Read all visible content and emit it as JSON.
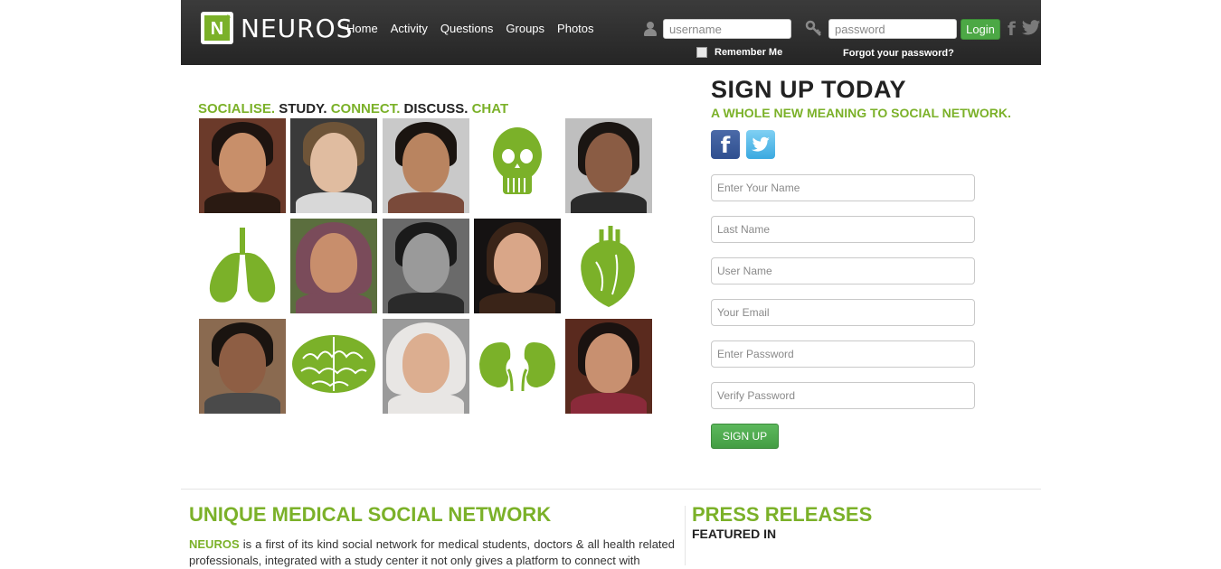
{
  "header": {
    "logo_letter": "N",
    "logo_text": "NEUROS",
    "nav": [
      "Home",
      "Activity",
      "Questions",
      "Groups",
      "Photos"
    ],
    "username_placeholder": "username",
    "password_placeholder": "password",
    "login_label": "Login",
    "remember_label": "Remember Me",
    "forgot_label": "Forgot your password?",
    "facebook_glyph": "f"
  },
  "hero": {
    "tagline": [
      {
        "text": "SOCIALISE.",
        "color": "green"
      },
      {
        "text": "STUDY.",
        "color": "dark"
      },
      {
        "text": "CONNECT.",
        "color": "green"
      },
      {
        "text": "DISCUSS.",
        "color": "dark"
      },
      {
        "text": "CHAT",
        "color": "green"
      }
    ],
    "tiles": [
      "photo",
      "photo",
      "photo",
      "skull-icon",
      "photo",
      "lungs-icon",
      "photo",
      "photo",
      "photo",
      "heart-icon",
      "photo",
      "brain-icon",
      "photo",
      "kidneys-icon",
      "photo"
    ]
  },
  "signup": {
    "title": "SIGN UP TODAY",
    "subtitle": "A WHOLE NEW MEANING TO SOCIAL NETWORK.",
    "facebook_glyph": "f",
    "fields": [
      "Enter Your Name",
      "Last Name",
      "User Name",
      "Your Email",
      "Enter Password",
      "Verify Password"
    ],
    "button": "SIGN UP"
  },
  "unique": {
    "heading": "UNIQUE MEDICAL SOCIAL NETWORK",
    "brand": "NEUROS",
    "text": " is a first of its kind social network for medical students, doctors & all health related professionals, integrated with a study center it not only gives a platform to connect with"
  },
  "press": {
    "heading": "PRESS RELEASES",
    "subheading": "FEATURED IN"
  },
  "colors": {
    "accent": "#7bb129",
    "dark": "#222222",
    "header_bg": "#2d2d2d",
    "login_green": "#4ca845"
  }
}
